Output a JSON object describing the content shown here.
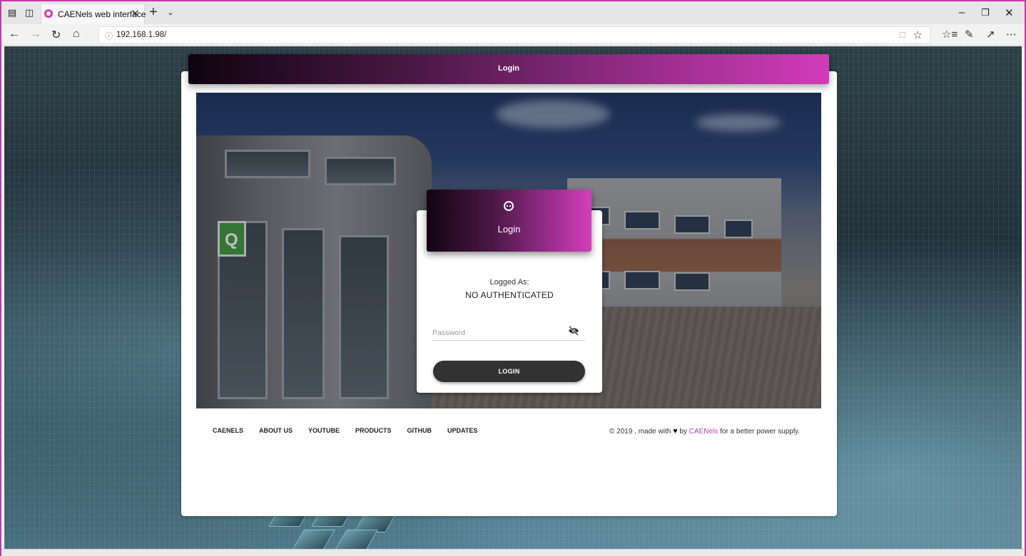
{
  "browser": {
    "tab_title": "CAENels web interface",
    "url": "192.168.1.98/"
  },
  "page": {
    "header_title": "Login",
    "login": {
      "title": "Login",
      "logged_label": "Logged As:",
      "logged_value": "NO AUTHENTICATED",
      "password_placeholder": "Password",
      "button_label": "LOGIN"
    },
    "footer": {
      "links": [
        "CAENELS",
        "ABOUT US",
        "YOUTUBE",
        "PRODUCTS",
        "GITHUB",
        "UPDATES"
      ],
      "credit_prefix": "© 2019 , made with",
      "credit_by": "by",
      "credit_brand": "CAENels",
      "credit_suffix": "for a better power supply."
    }
  },
  "colors": {
    "accent": "#d23bb9",
    "dark": "#0f0410",
    "button": "#323232"
  }
}
